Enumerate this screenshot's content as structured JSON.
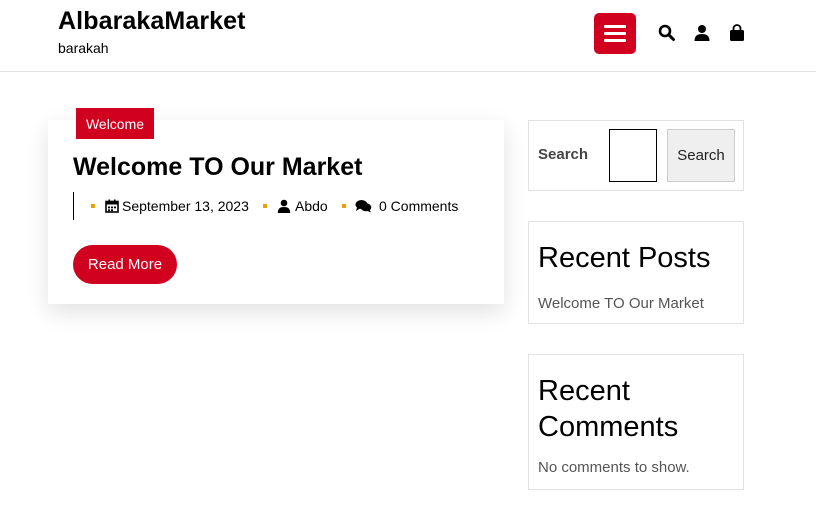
{
  "header": {
    "site_title": "AlbarakaMarket",
    "tagline": "barakah",
    "icons": [
      "menu-icon",
      "search-icon",
      "user-icon",
      "shopping-bag-icon"
    ],
    "accent_color": "#d1001f"
  },
  "post": {
    "category": "Welcome",
    "title": "Welcome TO Our Market",
    "date": "September 13, 2023",
    "author": "Abdo",
    "comments": "0 Comments",
    "read_more": "Read More"
  },
  "sidebar": {
    "search": {
      "label": "Search",
      "button": "Search",
      "value": ""
    },
    "recent_posts": {
      "heading": "Recent Posts",
      "items": [
        "Welcome TO Our Market"
      ]
    },
    "recent_comments": {
      "heading_line1": "Recent",
      "heading_line2": "Comments",
      "empty_text": "No comments to show."
    }
  }
}
